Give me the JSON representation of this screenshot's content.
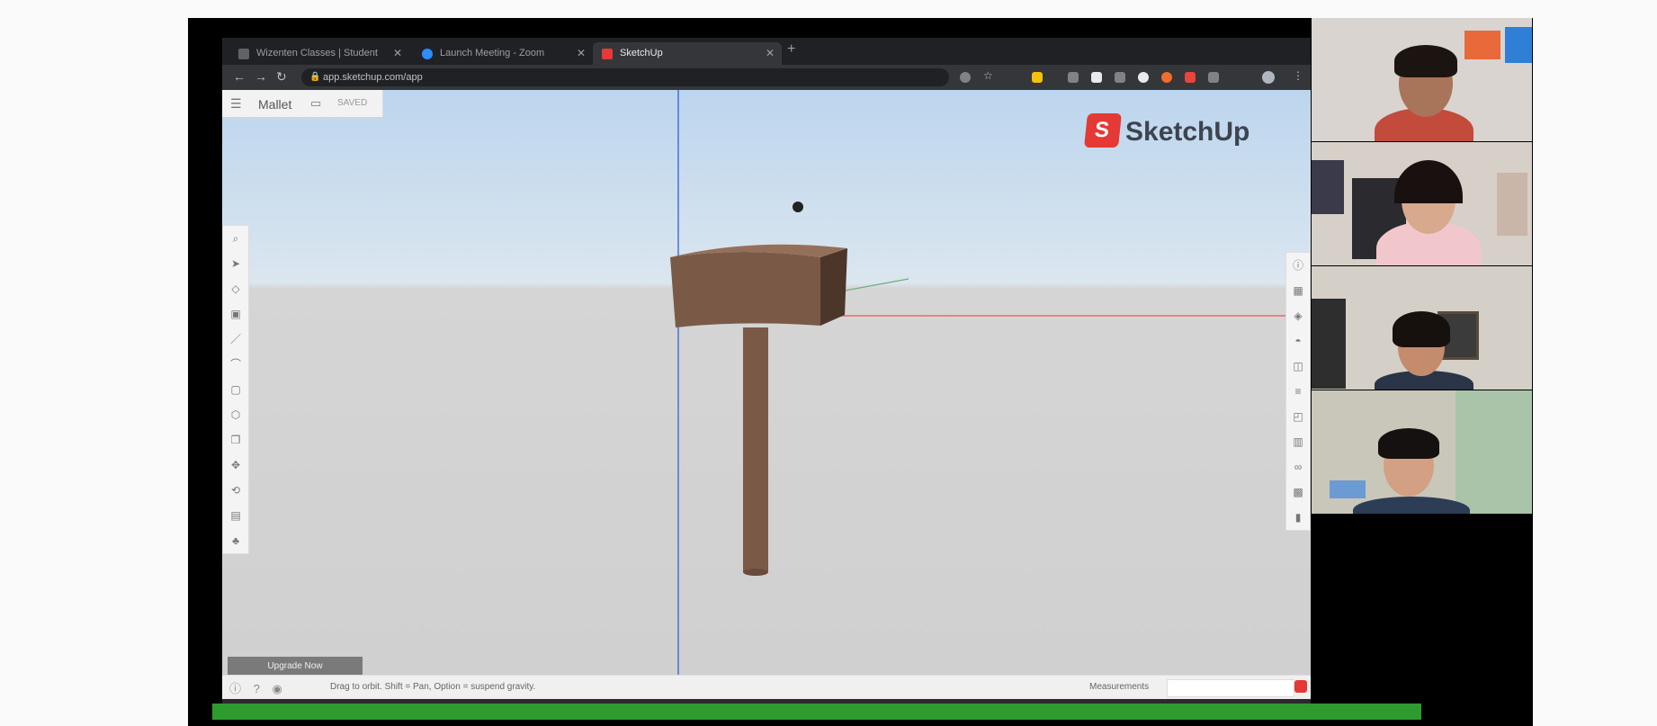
{
  "browser": {
    "tabs": [
      {
        "title": "Wizenten Classes | Student",
        "active": false,
        "favicon_color": "#5f6368"
      },
      {
        "title": "Launch Meeting - Zoom",
        "active": false,
        "favicon_color": "#2d8cff"
      },
      {
        "title": "SketchUp",
        "active": true,
        "favicon_color": "#e53935"
      }
    ],
    "new_tab_icon": "plus-icon",
    "url": "app.sketchup.com/app",
    "nav_icons": [
      "back-arrow-icon",
      "forward-arrow-icon",
      "reload-icon"
    ]
  },
  "sketchup": {
    "project_name": "Mallet",
    "project_status": "SAVED",
    "logo_text": "SketchUp",
    "left_tools": [
      "search-icon",
      "select-icon",
      "eraser-icon",
      "paint-bucket-icon",
      "pencil-icon",
      "arc-icon",
      "rectangle-icon",
      "push-pull-icon",
      "offset-icon",
      "move-icon",
      "orbit-icon",
      "tape-measure-icon",
      "walk-icon"
    ],
    "right_panels": [
      "entity-info-icon",
      "instructor-icon",
      "components-icon",
      "materials-icon",
      "styles-icon",
      "layers-icon",
      "scenes-icon",
      "outliner-icon",
      "display-icon",
      "view-icon",
      "solid-tools-icon"
    ],
    "upgrade_label": "Upgrade Now",
    "status_hint": "Drag to orbit. Shift = Pan, Option = suspend gravity.",
    "measurements_label": "Measurements",
    "colors": {
      "sky_top": "#bcd5ee",
      "ground": "#d0d0d0",
      "mallet_wood": "#7a5a47",
      "axis_red": "#e05a5a",
      "axis_blue": "#4a6fd8",
      "axis_green": "#6fae7a",
      "brand_red": "#e53935"
    }
  },
  "zoom_gallery": {
    "participants": [
      {
        "id": "participant-1",
        "bg": "#d9d4cf"
      },
      {
        "id": "participant-2",
        "bg": "#d7d0c8"
      },
      {
        "id": "participant-3",
        "bg": "#d5d0c7"
      },
      {
        "id": "participant-4",
        "bg": "#c9c7b9"
      }
    ]
  }
}
